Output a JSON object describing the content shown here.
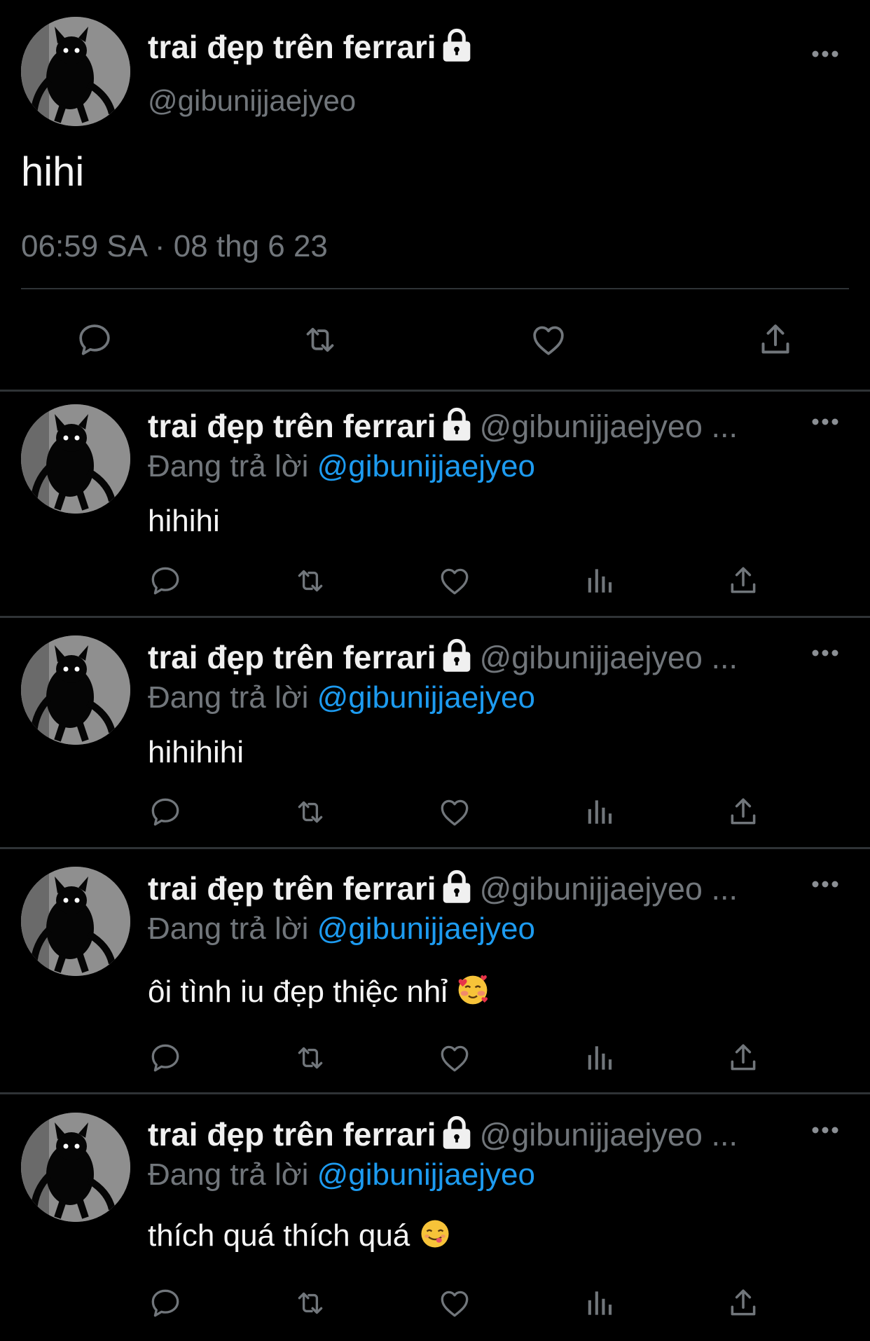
{
  "main_tweet": {
    "author_name": "trai đẹp trên ferrari",
    "handle": "@gibunijjaejyeo",
    "text": "hihi",
    "timestamp": "06:59 SA · 08 thg 6 23",
    "actions": [
      "reply-icon",
      "retweet-icon",
      "like-icon",
      "share-icon"
    ]
  },
  "replies": [
    {
      "author_name": "trai đẹp trên ferrari",
      "handle": "@gibunijjaejyeo ...",
      "replying_prefix": "Đang trả lời",
      "replying_to": "@gibunijjaejyeo",
      "text": "hihihi",
      "emoji": ""
    },
    {
      "author_name": "trai đẹp trên ferrari",
      "handle": "@gibunijjaejyeo ...",
      "replying_prefix": "Đang trả lời",
      "replying_to": "@gibunijjaejyeo",
      "text": "hihihihi",
      "emoji": ""
    },
    {
      "author_name": "trai đẹp trên ferrari",
      "handle": "@gibunijjaejyeo ...",
      "replying_prefix": "Đang trả lời",
      "replying_to": "@gibunijjaejyeo",
      "text": "ôi tình iu đẹp thiệc nhỉ",
      "emoji": "smiling-face-with-hearts"
    },
    {
      "author_name": "trai đẹp trên ferrari",
      "handle": "@gibunijjaejyeo ...",
      "replying_prefix": "Đang trả lời",
      "replying_to": "@gibunijjaejyeo",
      "text": "thích quá thích quá",
      "emoji": "face-savoring-food"
    }
  ],
  "colors": {
    "background": "#000000",
    "primary_text": "#e7e9ea",
    "secondary_text": "#71767b",
    "link": "#1d9bf0",
    "divider": "#2f3336"
  }
}
